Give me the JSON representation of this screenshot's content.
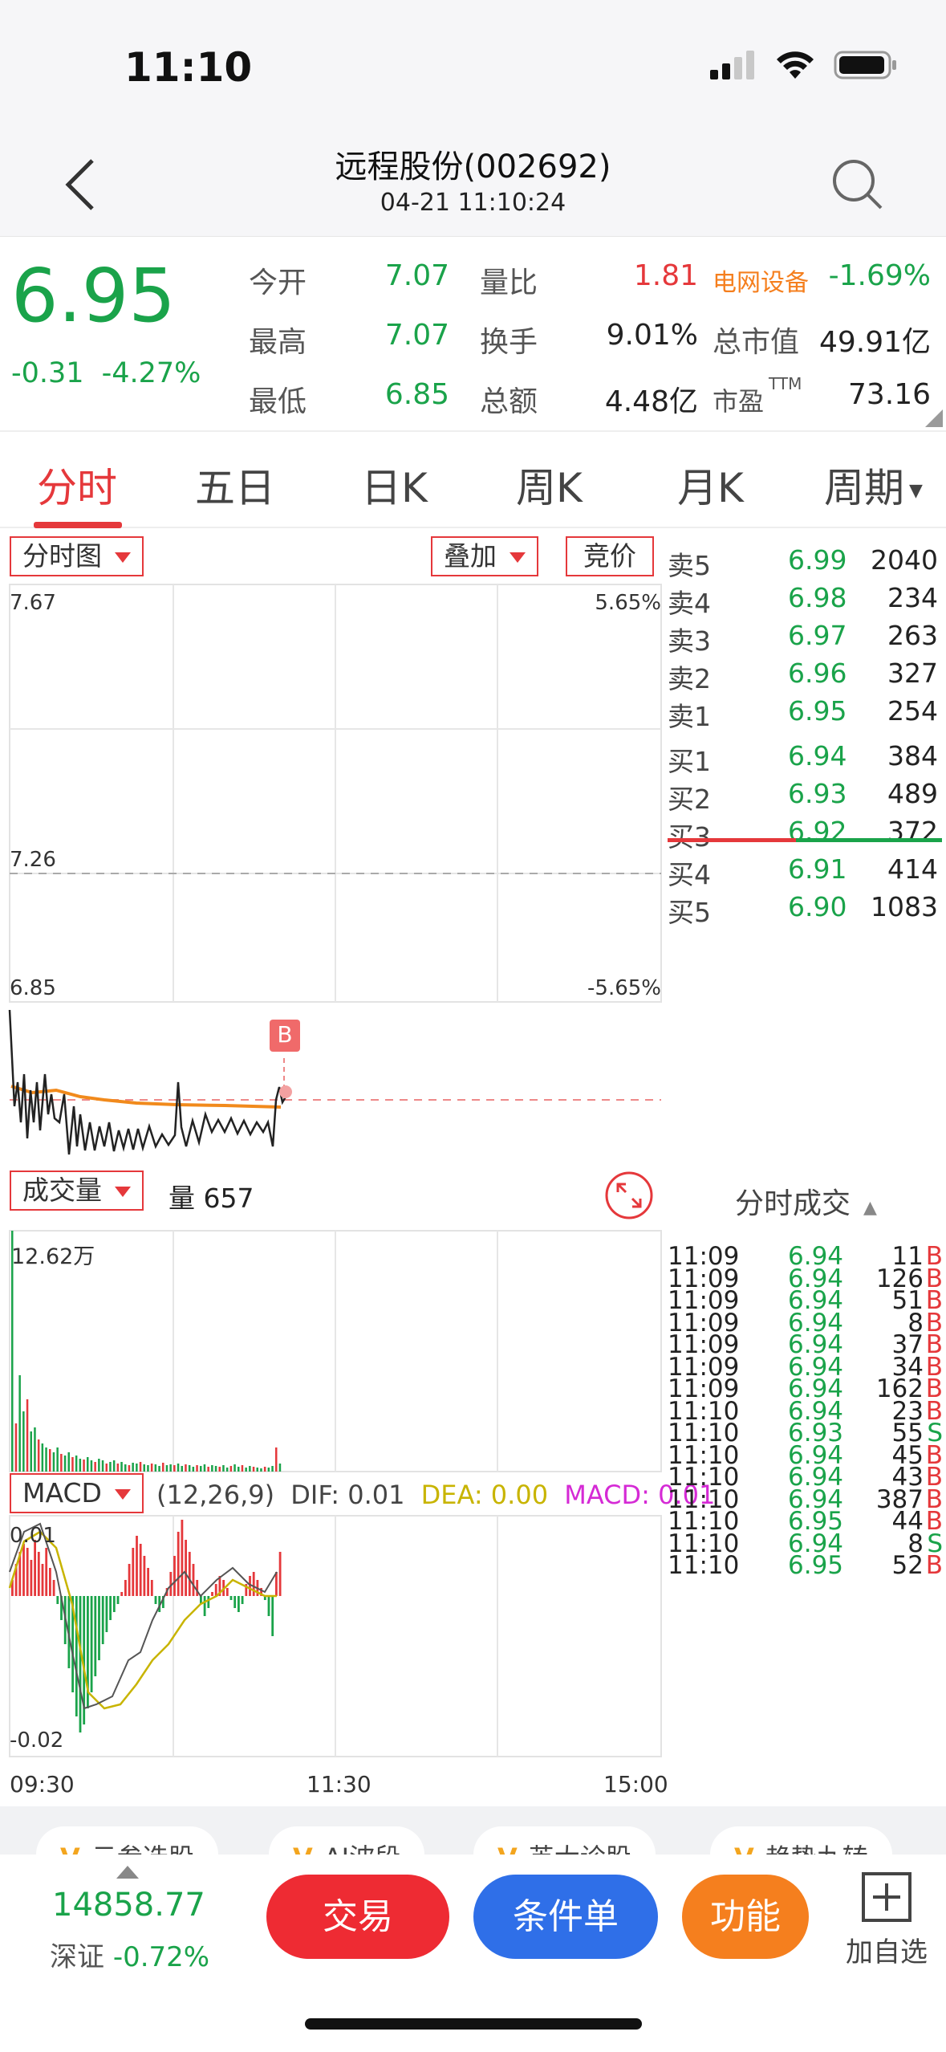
{
  "status": {
    "time": "11:10"
  },
  "header": {
    "title": "远程股份(002692)",
    "datetime": "04-21 11:10:24"
  },
  "quote": {
    "price": "6.95",
    "change": "-0.31",
    "change_pct": "-4.27%",
    "rows": [
      {
        "l1": "今开",
        "v1": "7.07",
        "l2": "量比",
        "v2": "1.81",
        "l3": "电网设备",
        "v3": "-1.69%"
      },
      {
        "l1": "最高",
        "v1": "7.07",
        "l2": "换手",
        "v2": "9.01%",
        "l3": "总市值",
        "v3": "49.91亿"
      },
      {
        "l1": "最低",
        "v1": "6.85",
        "l2": "总额",
        "v2": "4.48亿",
        "l3": "市盈",
        "l3_sup": "TTM",
        "v3": "73.16"
      }
    ]
  },
  "tabs": [
    {
      "label": "分时",
      "active": true
    },
    {
      "label": "五日"
    },
    {
      "label": "日K"
    },
    {
      "label": "周K"
    },
    {
      "label": "月K"
    },
    {
      "label": "周期"
    }
  ],
  "chart": {
    "type_label": "分时图",
    "overlay_label": "叠加",
    "auction_label": "竞价",
    "y_top": "7.67",
    "y_mid": "7.26",
    "y_bot": "6.85",
    "pct_top": "5.65%",
    "pct_bot": "-5.65%",
    "marker": "B",
    "volume_label": "成交量",
    "volume_text": "量 657",
    "volume_max": "12.62万",
    "macd_label": "MACD",
    "macd_params": "(12,26,9)",
    "macd_dif": "DIF: 0.01",
    "macd_dea": "DEA: 0.00",
    "macd_macd": "MACD: 0.01",
    "macd_top": "0.01",
    "macd_bot": "-0.02",
    "x_start": "09:30",
    "x_mid": "11:30",
    "x_end": "15:00"
  },
  "order_book": [
    {
      "label": "卖5",
      "price": "6.99",
      "vol": "2040"
    },
    {
      "label": "卖4",
      "price": "6.98",
      "vol": "234"
    },
    {
      "label": "卖3",
      "price": "6.97",
      "vol": "263"
    },
    {
      "label": "卖2",
      "price": "6.96",
      "vol": "327"
    },
    {
      "label": "卖1",
      "price": "6.95",
      "vol": "254"
    },
    {
      "label": "买1",
      "price": "6.94",
      "vol": "384"
    },
    {
      "label": "买2",
      "price": "6.93",
      "vol": "489"
    },
    {
      "label": "买3",
      "price": "6.92",
      "vol": "372"
    },
    {
      "label": "买4",
      "price": "6.91",
      "vol": "414"
    },
    {
      "label": "买5",
      "price": "6.90",
      "vol": "1083"
    }
  ],
  "ticks_title": "分时成交",
  "ticks": [
    {
      "time": "11:09",
      "price": "6.94",
      "vol": "11",
      "side": "B"
    },
    {
      "time": "11:09",
      "price": "6.94",
      "vol": "126",
      "side": "B"
    },
    {
      "time": "11:09",
      "price": "6.94",
      "vol": "51",
      "side": "B"
    },
    {
      "time": "11:09",
      "price": "6.94",
      "vol": "8",
      "side": "B"
    },
    {
      "time": "11:09",
      "price": "6.94",
      "vol": "37",
      "side": "B"
    },
    {
      "time": "11:09",
      "price": "6.94",
      "vol": "34",
      "side": "B"
    },
    {
      "time": "11:09",
      "price": "6.94",
      "vol": "162",
      "side": "B"
    },
    {
      "time": "11:10",
      "price": "6.94",
      "vol": "23",
      "side": "B"
    },
    {
      "time": "11:10",
      "price": "6.93",
      "vol": "55",
      "side": "S"
    },
    {
      "time": "11:10",
      "price": "6.94",
      "vol": "45",
      "side": "B"
    },
    {
      "time": "11:10",
      "price": "6.94",
      "vol": "43",
      "side": "B"
    },
    {
      "time": "11:10",
      "price": "6.94",
      "vol": "387",
      "side": "B"
    },
    {
      "time": "11:10",
      "price": "6.95",
      "vol": "44",
      "side": "B"
    },
    {
      "time": "11:10",
      "price": "6.94",
      "vol": "8",
      "side": "S"
    },
    {
      "time": "11:10",
      "price": "6.95",
      "vol": "52",
      "side": "B"
    }
  ],
  "chips": [
    {
      "icon": "V",
      "label": "云参选股"
    },
    {
      "icon": "V",
      "label": "AI波段"
    },
    {
      "icon": "V",
      "label": "英大诊股"
    },
    {
      "icon": "V",
      "label": "趋势九转"
    }
  ],
  "bottom": {
    "index_value": "14858.77",
    "index_name": "深证",
    "index_change": "-0.72%",
    "trade": "交易",
    "condition": "条件单",
    "function": "功能",
    "add_watch": "加自选"
  },
  "colors": {
    "up": "#e5383b",
    "down": "#1aa34a",
    "accent_blue": "#2f6fe8",
    "accent_orange": "#f57f1e"
  }
}
